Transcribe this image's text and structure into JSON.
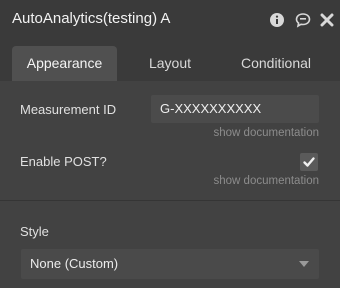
{
  "window": {
    "title": "AutoAnalytics(testing) A",
    "icons": [
      "info-icon",
      "chat-icon",
      "close-icon"
    ]
  },
  "tabs": [
    {
      "label": "Appearance",
      "active": true
    },
    {
      "label": "Layout",
      "active": false
    },
    {
      "label": "Conditional",
      "active": false
    }
  ],
  "fields": {
    "measurement_id": {
      "label": "Measurement ID",
      "value": "G-XXXXXXXXXX",
      "doc_link": "show documentation"
    },
    "enable_post": {
      "label": "Enable POST?",
      "checked": true,
      "doc_link": "show documentation"
    },
    "style": {
      "label": "Style",
      "selected": "None (Custom)"
    }
  },
  "colors": {
    "background": "#424242",
    "header": "#3a3a3a",
    "active_tab": "#505050",
    "muted_text": "#8c8c8c"
  }
}
